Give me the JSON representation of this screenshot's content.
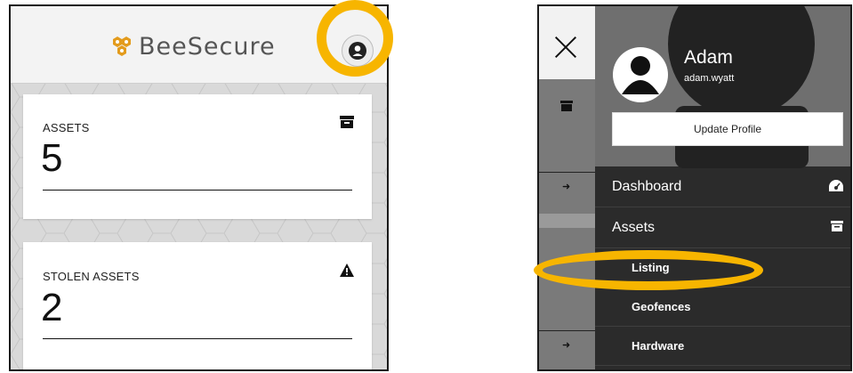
{
  "left_panel": {
    "brand": {
      "name": "BeeSecure",
      "logo_icon": "beesecure-logo-icon"
    },
    "profile_button_icon": "user-circle-icon",
    "cards": [
      {
        "label": "ASSETS",
        "value": "5",
        "icon": "archive-icon"
      },
      {
        "label": "STOLEN ASSETS",
        "value": "2",
        "icon": "warning-icon"
      }
    ]
  },
  "right_panel": {
    "close_icon": "close-icon",
    "user": {
      "name": "Adam",
      "handle": "adam.wyatt",
      "avatar_icon": "user-circle-icon"
    },
    "update_profile_label": "Update Profile",
    "menu": [
      {
        "label": "Dashboard",
        "icon": "dashboard-gauge-icon"
      },
      {
        "label": "Assets",
        "icon": "archive-icon"
      }
    ],
    "submenu": [
      {
        "label": "Listing"
      },
      {
        "label": "Geofences"
      },
      {
        "label": "Hardware"
      }
    ]
  },
  "colors": {
    "highlight": "#f7b500",
    "drawer_bg": "#2b2b2b",
    "header_bg": "#f3f3f3"
  }
}
